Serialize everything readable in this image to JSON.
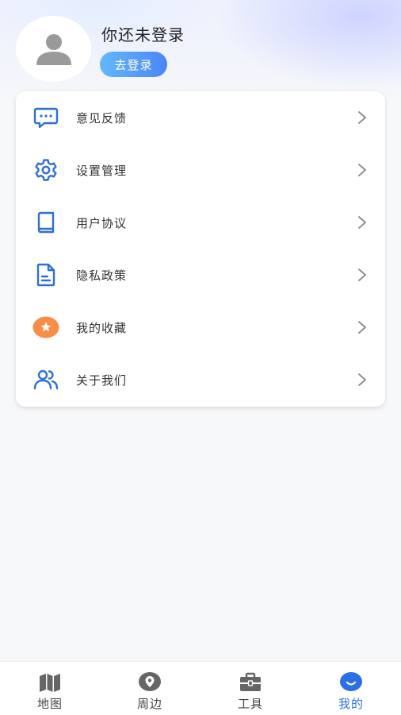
{
  "profile": {
    "title": "你还未登录",
    "login_label": "去登录"
  },
  "menu": {
    "items": [
      {
        "label": "意见反馈",
        "icon": "feedback-icon"
      },
      {
        "label": "设置管理",
        "icon": "settings-gear-icon"
      },
      {
        "label": "用户协议",
        "icon": "book-icon"
      },
      {
        "label": "隐私政策",
        "icon": "document-icon"
      },
      {
        "label": "我的收藏",
        "icon": "star-icon"
      },
      {
        "label": "关于我们",
        "icon": "people-icon"
      }
    ]
  },
  "tabbar": {
    "tabs": [
      {
        "label": "地图",
        "icon": "map-icon",
        "active": false
      },
      {
        "label": "周边",
        "icon": "location-pin-icon",
        "active": false
      },
      {
        "label": "工具",
        "icon": "toolbox-icon",
        "active": false
      },
      {
        "label": "我的",
        "icon": "smile-icon",
        "active": true
      }
    ]
  },
  "colors": {
    "accent": "#2b6fe6",
    "icon_blue": "#2f6fd6",
    "favorite_orange": "#f98d46",
    "chevron": "#8a8f99",
    "tab_inactive": "#666666"
  }
}
